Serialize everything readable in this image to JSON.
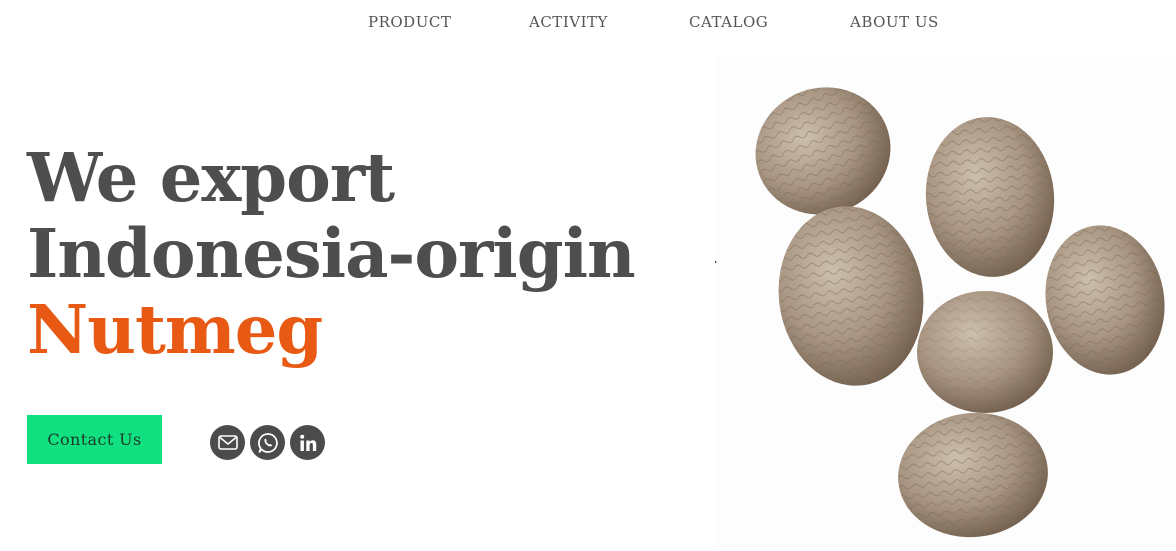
{
  "nav": {
    "items": [
      {
        "label": "PRODUCT"
      },
      {
        "label": "ACTIVITY"
      },
      {
        "label": "CATALOG"
      },
      {
        "label": "ABOUT US"
      }
    ]
  },
  "hero": {
    "title_line1": "We export",
    "title_line2": "Indonesia-origin",
    "title_accent": "Nutmeg",
    "accent_color": "#e85a14",
    "cta_label": "Contact Us",
    "cta_color": "#10e07f"
  },
  "social": {
    "icons": [
      "mail-icon",
      "whatsapp-icon",
      "linkedin-icon"
    ]
  },
  "image": {
    "subject": "nutmeg-seeds-photo"
  }
}
